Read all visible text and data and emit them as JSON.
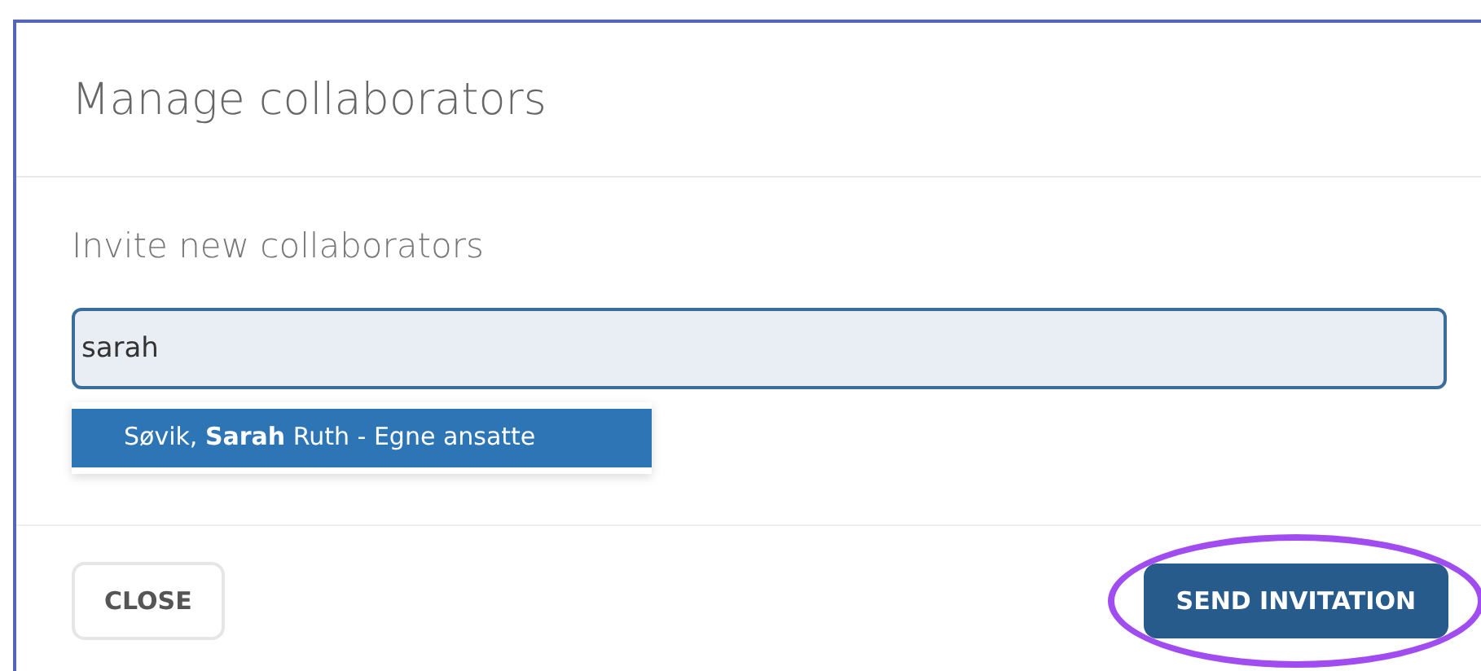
{
  "dialog": {
    "title": "Manage collaborators"
  },
  "invite": {
    "label": "Invite new collaborators",
    "value": "sarah"
  },
  "suggestions": [
    {
      "text": "Søvik, **Sarah** Ruth - Egne ansatte",
      "selected": true
    }
  ],
  "buttons": [
    {
      "label": "CLOSE",
      "kind": "secondary",
      "highlighted": false
    },
    {
      "label": "SEND INVITATION",
      "kind": "primary",
      "highlighted": true
    }
  ]
}
